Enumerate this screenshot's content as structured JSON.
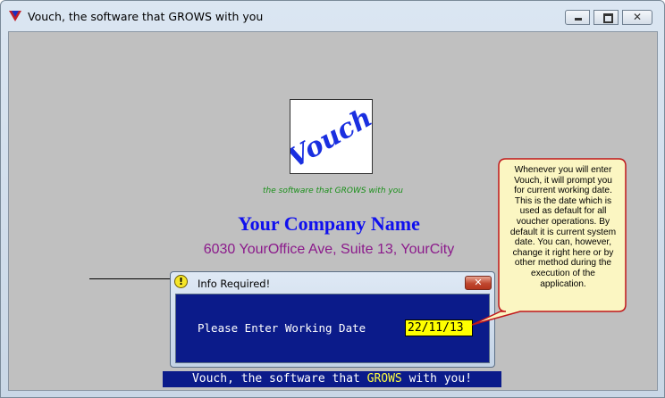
{
  "window": {
    "title": "Vouch, the software that GROWS with you",
    "minimize_glyph": "",
    "maximize_glyph": "",
    "close_glyph": "✕"
  },
  "splash": {
    "logo_text": "Vouch",
    "tagline": "the software that GROWS with you",
    "company_name": "Your Company Name",
    "address": "6030 YourOffice Ave, Suite 13, YourCity",
    "footer_before": "Vouch, the software that ",
    "footer_highlight": "GROWS",
    "footer_after": " with you!"
  },
  "dialog": {
    "title": "Info Required!",
    "icon_glyph": "!",
    "close_glyph": "✕",
    "prompt": "Please Enter Working Date",
    "date_value": "22/11/13"
  },
  "callout": {
    "lines": [
      "Whenever you will enter",
      "Vouch, it will prompt you",
      "for current working date.",
      "This is the date which is",
      "used as default for all",
      "voucher operations. By",
      "default it is current system",
      "date. You can, however,",
      "change it right here or by",
      "other method during the",
      "execution of the",
      "application."
    ]
  },
  "colors": {
    "client_bg": "#c0c0c0",
    "company": "#1010ee",
    "address": "#8b1a8b",
    "tagline": "#1a8f1a",
    "navy": "#0b1b8a",
    "date_bg": "#ffff00",
    "callout_bg": "#fbf6c2",
    "callout_border": "#c0171b"
  }
}
